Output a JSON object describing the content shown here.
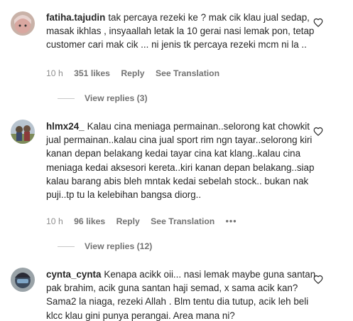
{
  "comments": [
    {
      "username": "fatiha.tajudin",
      "text": "tak percaya rezeki ke ? mak cik klau jual sedap, masak ikhlas , insyaallah letak la 10 gerai nasi lemak pon, tetap customer cari mak cik ... ni jenis tk percaya rezeki mcm ni la ..",
      "time": "10 h",
      "likes": "351 likes",
      "reply": "Reply",
      "translate": "See Translation",
      "view_replies": "View replies (3)"
    },
    {
      "username": "hlmx24_",
      "text": "Kalau cina meniaga permainan..selorong kat chowkit jual permainan..kalau cina jual sport rim ngn tayar..selorong kiri kanan depan belakang kedai tayar cina kat klang..kalau cina meniaga kedai aksesori kereta..kiri kanan depan belakang..siap kalau barang abis bleh mntak kedai sebelah stock.. bukan nak puji..tp tu la kelebihan bangsa diorg..",
      "time": "10 h",
      "likes": "96 likes",
      "reply": "Reply",
      "translate": "See Translation",
      "more": "•••",
      "view_replies": "View replies (12)"
    },
    {
      "username": "cynta_cynta",
      "text": "Kenapa acikk oii... nasi lemak maybe guna santan pak brahim, acik guna santan haji semad, x sama acik kan? Sama2 la niaga, rezeki Allah . Blm tentu dia tutup, acik leh beli klcc klau gini punya perangai. Area mana ni?"
    }
  ],
  "icons": {
    "like": "heart-icon",
    "more": "more-options-icon"
  },
  "colors": {
    "text": "#262626",
    "secondary": "#8e8e8e",
    "divider": "#c7c7c7"
  }
}
